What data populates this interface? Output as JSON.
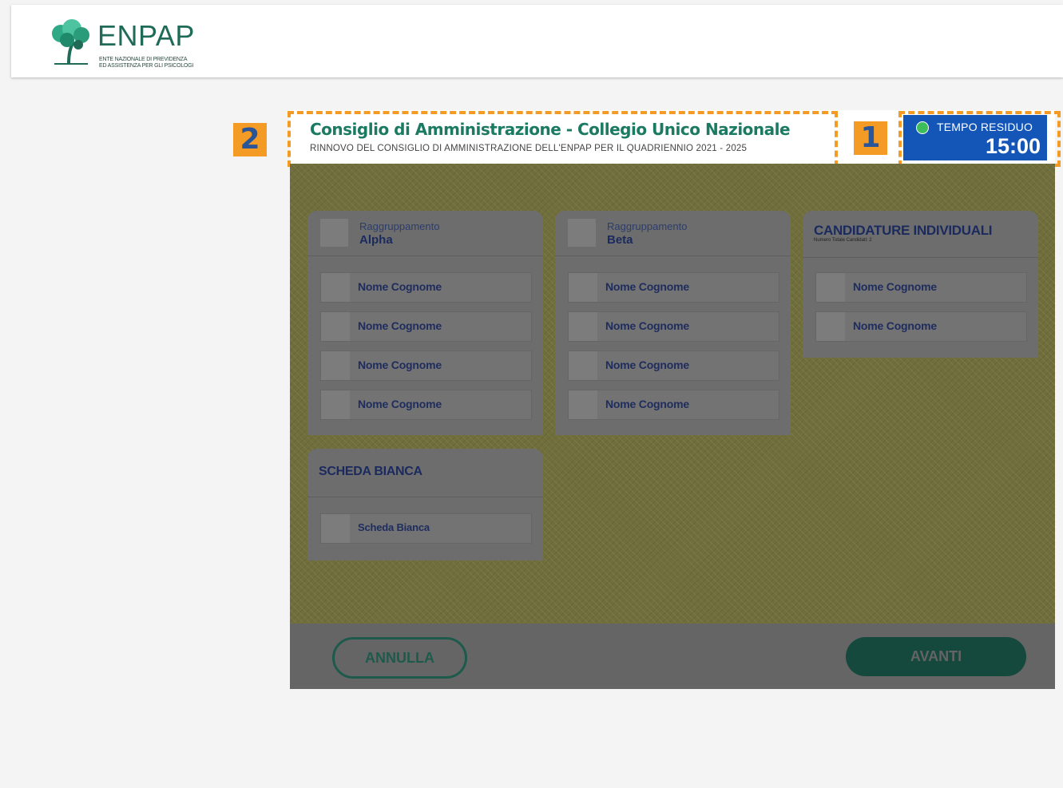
{
  "app": {
    "logo_name": "ENPAP",
    "logo_sub_line1": "ENTE NAZIONALE DI PREVIDENZA",
    "logo_sub_line2": "ED ASSISTENZA PER GLI PSICOLOGI"
  },
  "election": {
    "title": "Consiglio di Amministrazione - Collegio Unico Nazionale",
    "subtitle": "RINNOVO DEL CONSIGLIO DI AMMINISTRAZIONE DELL'ENPAP PER IL QUADRIENNIO  2021 - 2025"
  },
  "callouts": {
    "badge_1": "1",
    "badge_2": "2",
    "color": "#f49b25"
  },
  "timer": {
    "label": "TEMPO RESIDUO",
    "value": "15:00",
    "status_color": "#3dbd5c"
  },
  "groups": [
    {
      "prefix": "Raggruppamento",
      "name": "Alpha",
      "candidates": [
        "Nome Cognome",
        "Nome Cognome",
        "Nome Cognome",
        "Nome Cognome"
      ]
    },
    {
      "prefix": "Raggruppamento",
      "name": "Beta",
      "candidates": [
        "Nome Cognome",
        "Nome Cognome",
        "Nome Cognome",
        "Nome Cognome"
      ]
    }
  ],
  "individual": {
    "title": "CANDIDATURE INDIVIDUALI",
    "note": "Numero Totale Candidati: 2",
    "candidates": [
      "Nome Cognome",
      "Nome Cognome"
    ]
  },
  "blank": {
    "title": "SCHEDA BIANCA",
    "option": "Scheda Bianca"
  },
  "footer": {
    "cancel_label": "ANNULLA",
    "next_label": "AVANTI"
  },
  "colors": {
    "brand_green": "#1f6b58",
    "timer_blue": "#1455b8"
  }
}
